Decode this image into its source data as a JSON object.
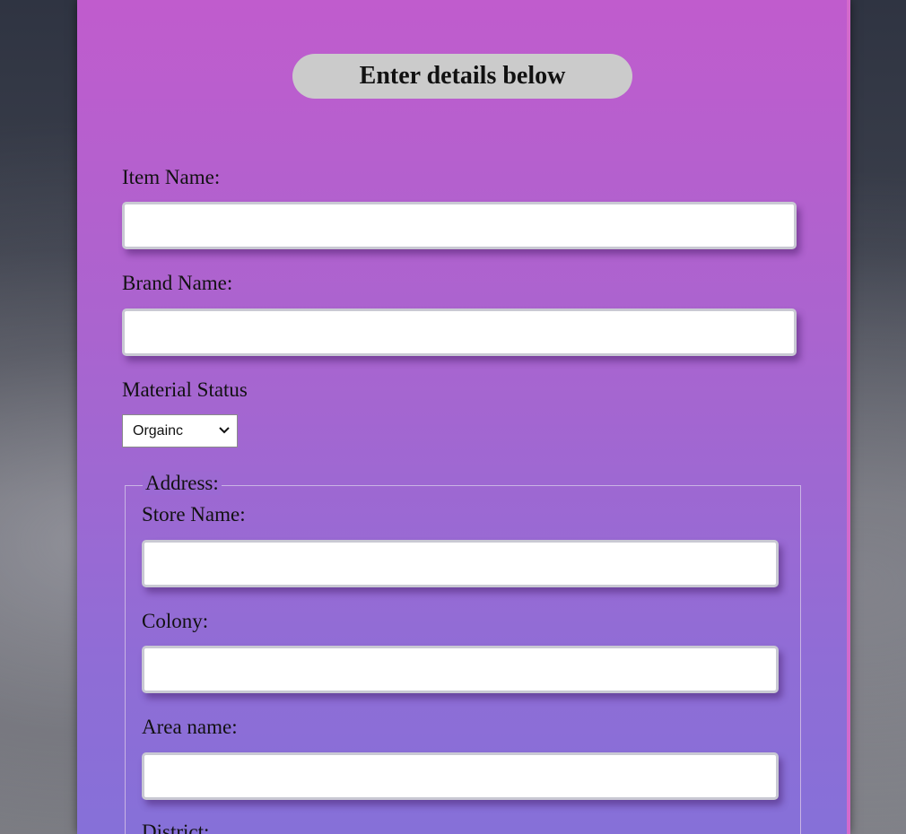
{
  "form": {
    "title": "Enter details below",
    "item_name_label": "Item Name:",
    "item_name_value": "",
    "brand_name_label": "Brand Name:",
    "brand_name_value": "",
    "material_status_label": "Material Status",
    "material_status_selected": "Orgainc",
    "address": {
      "legend": "Address:",
      "store_name_label": "Store Name:",
      "store_name_value": "",
      "colony_label": "Colony:",
      "colony_value": "",
      "area_name_label": "Area name:",
      "area_name_value": "",
      "district_label": "District:"
    }
  },
  "colors": {
    "card_top": "#c05ccd",
    "card_bottom": "#8670d8",
    "title_pill": "#cbcbcb"
  },
  "icons": {
    "select_arrow": "chevron-down-icon"
  }
}
